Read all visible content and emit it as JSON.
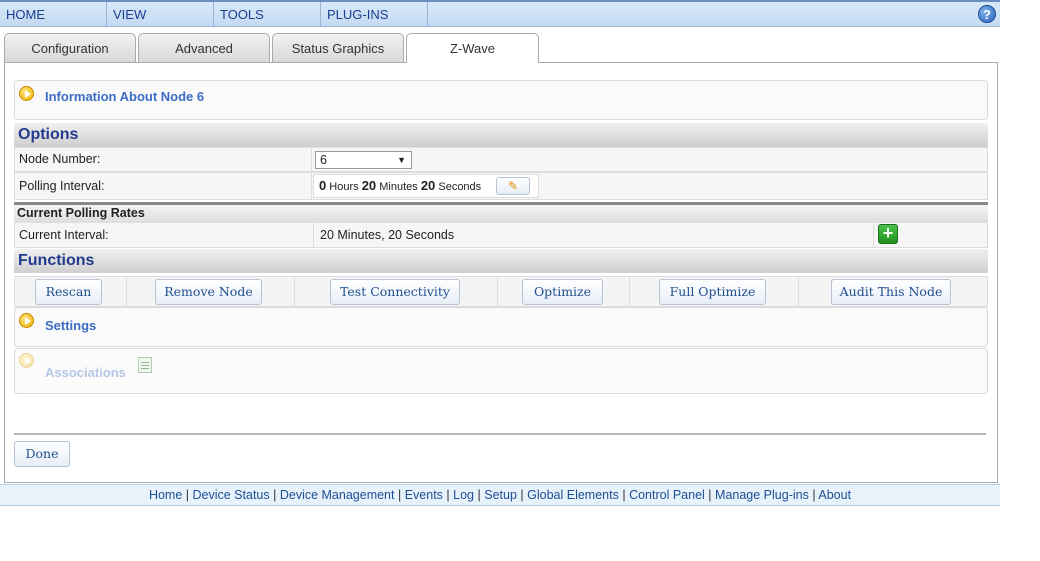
{
  "menubar": {
    "items": [
      "HOME",
      "VIEW",
      "TOOLS",
      "PLUG-INS"
    ],
    "help_icon": "help-icon"
  },
  "tabs": [
    {
      "label": "Configuration",
      "active": false
    },
    {
      "label": "Advanced",
      "active": false
    },
    {
      "label": "Status Graphics",
      "active": false
    },
    {
      "label": "Z-Wave",
      "active": true
    }
  ],
  "info_section": {
    "title": "Information About Node 6",
    "icon": "expand-arrow-icon"
  },
  "options": {
    "heading": "Options",
    "node_number_label": "Node Number:",
    "node_number_value": "6",
    "polling_label": "Polling Interval:",
    "polling": {
      "hours": "0",
      "hours_unit": "Hours",
      "minutes": "20",
      "minutes_unit": "Minutes",
      "seconds": "20",
      "seconds_unit": "Seconds"
    },
    "edit_icon": "pencil-icon"
  },
  "polling_rates": {
    "heading": "Current Polling Rates",
    "interval_label": "Current Interval:",
    "interval_value": "20 Minutes, 20 Seconds",
    "add_icon": "green-plus-icon"
  },
  "functions": {
    "heading": "Functions",
    "buttons": [
      "Rescan",
      "Remove Node",
      "Test Connectivity",
      "Optimize",
      "Full Optimize",
      "Audit This Node"
    ]
  },
  "settings_section": {
    "title": "Settings"
  },
  "associations_section": {
    "title": "Associations",
    "icon": "notepad-icon"
  },
  "done_button": "Done",
  "footer_links": [
    "Home",
    "Device Status",
    "Device Management",
    "Events",
    "Log",
    "Setup",
    "Global Elements",
    "Control Panel",
    "Manage Plug-ins",
    "About"
  ],
  "footer_separator": "|",
  "colors": {
    "accent": "#3c6cc4",
    "header_text": "#223b8c",
    "link": "#1d4f94",
    "add_green": "#2aa02a"
  }
}
